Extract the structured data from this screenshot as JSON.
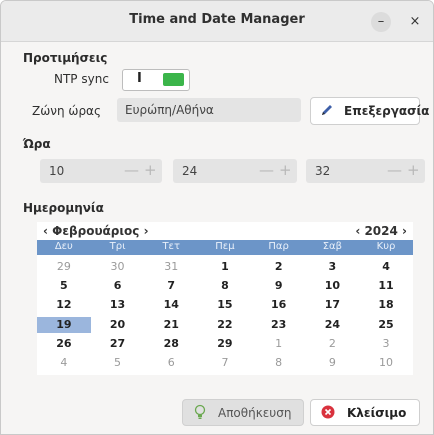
{
  "window": {
    "title": "Time and Date Manager",
    "minimize_icon": "minimize-icon",
    "close_icon": "close-icon",
    "minimize_glyph": "–",
    "close_glyph": "×"
  },
  "preferences": {
    "section_title": "Προτιμήσεις",
    "ntp_label": "NTP sync",
    "ntp_state": "I",
    "ntp_enabled": true,
    "timezone_label": "Ζώνη ώρας",
    "timezone_value": "Ευρώπη/Αθήνα",
    "edit_label": "Επεξεργασία",
    "edit_icon": "pencil-icon"
  },
  "time": {
    "section_title": "Ώρα",
    "hours": "10",
    "minutes": "24",
    "seconds": "32",
    "minus_glyph": "—",
    "plus_glyph": "+"
  },
  "date": {
    "section_title": "Ημερομηνία",
    "month_prev": "‹",
    "month": "Φεβρουάριος",
    "month_next": "›",
    "year_prev": "‹",
    "year": "2024",
    "year_next": "›",
    "weekdays": [
      "Δευ",
      "Τρι",
      "Τετ",
      "Πεμ",
      "Παρ",
      "Σαβ",
      "Κυρ"
    ],
    "weeks": [
      [
        {
          "d": "29",
          "m": false
        },
        {
          "d": "30",
          "m": false
        },
        {
          "d": "31",
          "m": false
        },
        {
          "d": "1",
          "m": true
        },
        {
          "d": "2",
          "m": true
        },
        {
          "d": "3",
          "m": true
        },
        {
          "d": "4",
          "m": true
        }
      ],
      [
        {
          "d": "5",
          "m": true
        },
        {
          "d": "6",
          "m": true
        },
        {
          "d": "7",
          "m": true
        },
        {
          "d": "8",
          "m": true
        },
        {
          "d": "9",
          "m": true
        },
        {
          "d": "10",
          "m": true
        },
        {
          "d": "11",
          "m": true
        }
      ],
      [
        {
          "d": "12",
          "m": true
        },
        {
          "d": "13",
          "m": true
        },
        {
          "d": "14",
          "m": true
        },
        {
          "d": "15",
          "m": true
        },
        {
          "d": "16",
          "m": true
        },
        {
          "d": "17",
          "m": true
        },
        {
          "d": "18",
          "m": true
        }
      ],
      [
        {
          "d": "19",
          "m": true,
          "selected": true
        },
        {
          "d": "20",
          "m": true
        },
        {
          "d": "21",
          "m": true
        },
        {
          "d": "22",
          "m": true
        },
        {
          "d": "23",
          "m": true
        },
        {
          "d": "24",
          "m": true
        },
        {
          "d": "25",
          "m": true
        }
      ],
      [
        {
          "d": "26",
          "m": true
        },
        {
          "d": "27",
          "m": true
        },
        {
          "d": "28",
          "m": true
        },
        {
          "d": "29",
          "m": true
        },
        {
          "d": "1",
          "m": false
        },
        {
          "d": "2",
          "m": false
        },
        {
          "d": "3",
          "m": false
        }
      ],
      [
        {
          "d": "4",
          "m": false
        },
        {
          "d": "5",
          "m": false
        },
        {
          "d": "6",
          "m": false
        },
        {
          "d": "7",
          "m": false
        },
        {
          "d": "8",
          "m": false
        },
        {
          "d": "9",
          "m": false
        },
        {
          "d": "10",
          "m": false
        }
      ]
    ]
  },
  "actions": {
    "save_label": "Αποθήκευση",
    "save_icon": "lightbulb-icon",
    "close_label": "Κλείσιμο",
    "close_icon": "close-circle-icon"
  },
  "colors": {
    "accent": "#6c95c8",
    "selected_day": "#9bb6dd",
    "toggle_on": "#3bb54a",
    "close_red": "#d9323e"
  }
}
